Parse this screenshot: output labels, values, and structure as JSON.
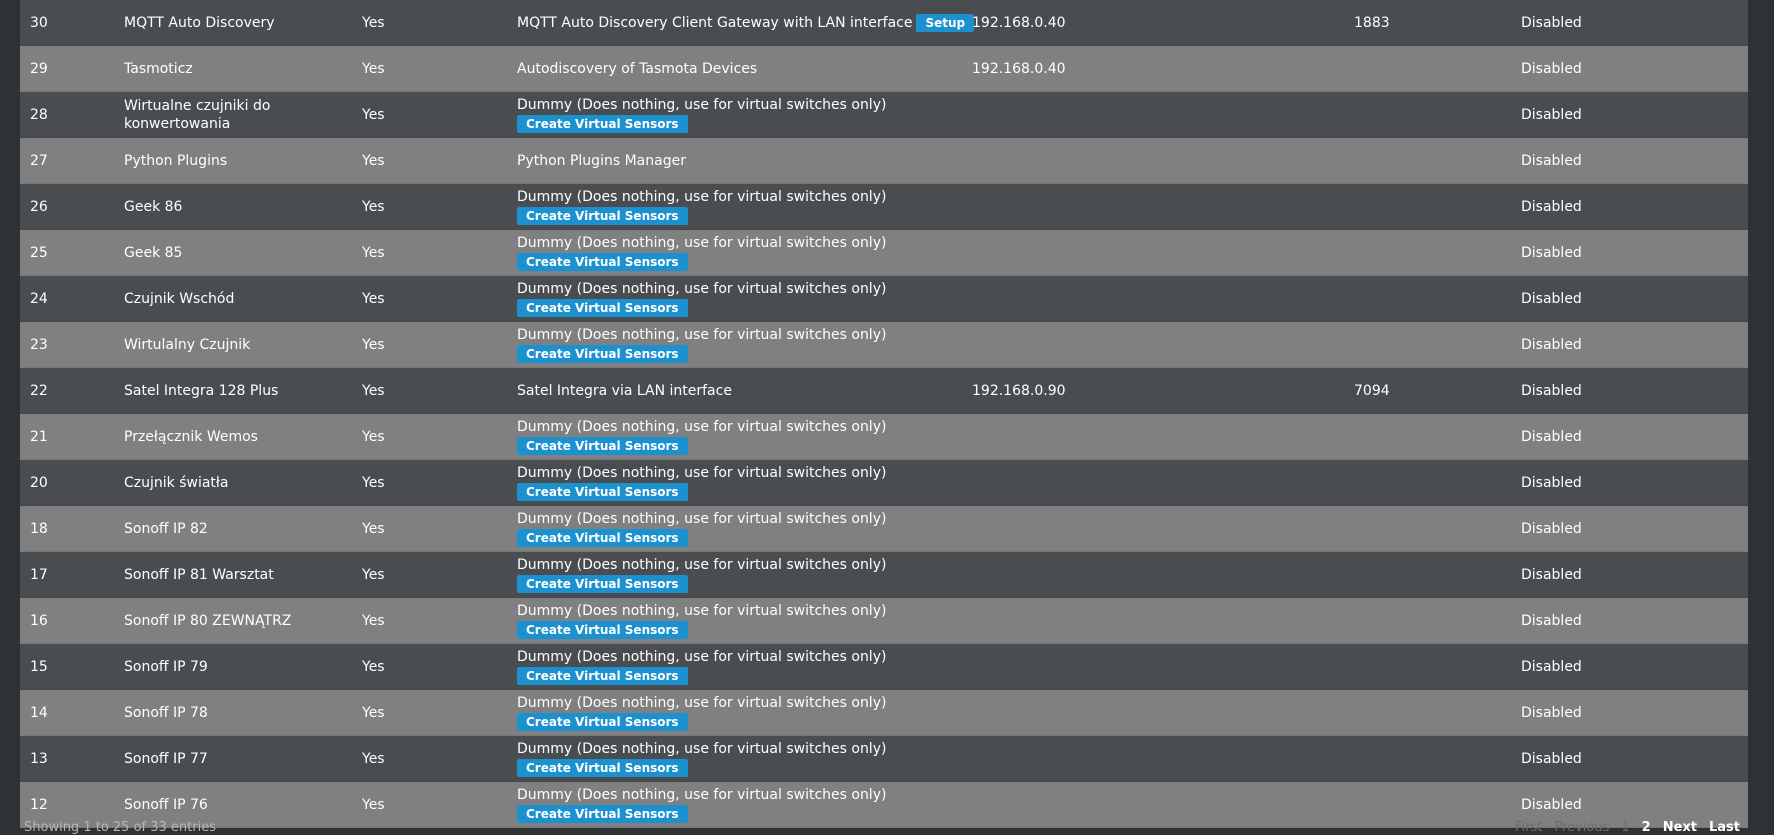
{
  "table": {
    "rows": [
      {
        "idx": "30",
        "name": "MQTT Auto Discovery",
        "enabled": "Yes",
        "hardware": "MQTT Auto Discovery Client Gateway with LAN interface",
        "button": "Setup",
        "ip": "192.168.0.40",
        "port": "1883",
        "status": "Disabled"
      },
      {
        "idx": "29",
        "name": "Tasmoticz",
        "enabled": "Yes",
        "hardware": "Autodiscovery of Tasmota Devices",
        "button": "",
        "ip": "192.168.0.40",
        "port": "",
        "status": "Disabled"
      },
      {
        "idx": "28",
        "name": "Wirtualne czujniki do konwertowania",
        "enabled": "Yes",
        "hardware": "Dummy (Does nothing, use for virtual switches only)",
        "button": "Create Virtual Sensors",
        "ip": "",
        "port": "",
        "status": "Disabled"
      },
      {
        "idx": "27",
        "name": "Python Plugins",
        "enabled": "Yes",
        "hardware": "Python Plugins Manager",
        "button": "",
        "ip": "",
        "port": "",
        "status": "Disabled"
      },
      {
        "idx": "26",
        "name": "Geek 86",
        "enabled": "Yes",
        "hardware": "Dummy (Does nothing, use for virtual switches only)",
        "button": "Create Virtual Sensors",
        "ip": "",
        "port": "",
        "status": "Disabled"
      },
      {
        "idx": "25",
        "name": "Geek 85",
        "enabled": "Yes",
        "hardware": "Dummy (Does nothing, use for virtual switches only)",
        "button": "Create Virtual Sensors",
        "ip": "",
        "port": "",
        "status": "Disabled"
      },
      {
        "idx": "24",
        "name": "Czujnik Wschód",
        "enabled": "Yes",
        "hardware": "Dummy (Does nothing, use for virtual switches only)",
        "button": "Create Virtual Sensors",
        "ip": "",
        "port": "",
        "status": "Disabled"
      },
      {
        "idx": "23",
        "name": "Wirtulalny Czujnik",
        "enabled": "Yes",
        "hardware": "Dummy (Does nothing, use for virtual switches only)",
        "button": "Create Virtual Sensors",
        "ip": "",
        "port": "",
        "status": "Disabled"
      },
      {
        "idx": "22",
        "name": "Satel Integra 128 Plus",
        "enabled": "Yes",
        "hardware": "Satel Integra via LAN interface",
        "button": "",
        "ip": "192.168.0.90",
        "port": "7094",
        "status": "Disabled"
      },
      {
        "idx": "21",
        "name": "Przełącznik Wemos",
        "enabled": "Yes",
        "hardware": "Dummy (Does nothing, use for virtual switches only)",
        "button": "Create Virtual Sensors",
        "ip": "",
        "port": "",
        "status": "Disabled"
      },
      {
        "idx": "20",
        "name": "Czujnik światła",
        "enabled": "Yes",
        "hardware": "Dummy (Does nothing, use for virtual switches only)",
        "button": "Create Virtual Sensors",
        "ip": "",
        "port": "",
        "status": "Disabled"
      },
      {
        "idx": "18",
        "name": "Sonoff IP 82",
        "enabled": "Yes",
        "hardware": "Dummy (Does nothing, use for virtual switches only)",
        "button": "Create Virtual Sensors",
        "ip": "",
        "port": "",
        "status": "Disabled"
      },
      {
        "idx": "17",
        "name": "Sonoff IP 81 Warsztat",
        "enabled": "Yes",
        "hardware": "Dummy (Does nothing, use for virtual switches only)",
        "button": "Create Virtual Sensors",
        "ip": "",
        "port": "",
        "status": "Disabled"
      },
      {
        "idx": "16",
        "name": "Sonoff IP 80 ZEWNĄTRZ",
        "enabled": "Yes",
        "hardware": "Dummy (Does nothing, use for virtual switches only)",
        "button": "Create Virtual Sensors",
        "ip": "",
        "port": "",
        "status": "Disabled"
      },
      {
        "idx": "15",
        "name": "Sonoff IP 79",
        "enabled": "Yes",
        "hardware": "Dummy (Does nothing, use for virtual switches only)",
        "button": "Create Virtual Sensors",
        "ip": "",
        "port": "",
        "status": "Disabled"
      },
      {
        "idx": "14",
        "name": "Sonoff IP 78",
        "enabled": "Yes",
        "hardware": "Dummy (Does nothing, use for virtual switches only)",
        "button": "Create Virtual Sensors",
        "ip": "",
        "port": "",
        "status": "Disabled"
      },
      {
        "idx": "13",
        "name": "Sonoff IP 77",
        "enabled": "Yes",
        "hardware": "Dummy (Does nothing, use for virtual switches only)",
        "button": "Create Virtual Sensors",
        "ip": "",
        "port": "",
        "status": "Disabled"
      },
      {
        "idx": "12",
        "name": "Sonoff IP 76",
        "enabled": "Yes",
        "hardware": "Dummy (Does nothing, use for virtual switches only)",
        "button": "Create Virtual Sensors",
        "ip": "",
        "port": "",
        "status": "Disabled"
      }
    ]
  },
  "footer": {
    "info": "Showing 1 to 25 of 33 entries"
  },
  "pagination": {
    "first": "First",
    "previous": "Previous",
    "page1": "1",
    "page2": "2",
    "next": "Next",
    "last": "Last"
  },
  "colors": {
    "row_dark": "#4a4d50",
    "row_light": "#808080",
    "button": "#1c91d0"
  }
}
